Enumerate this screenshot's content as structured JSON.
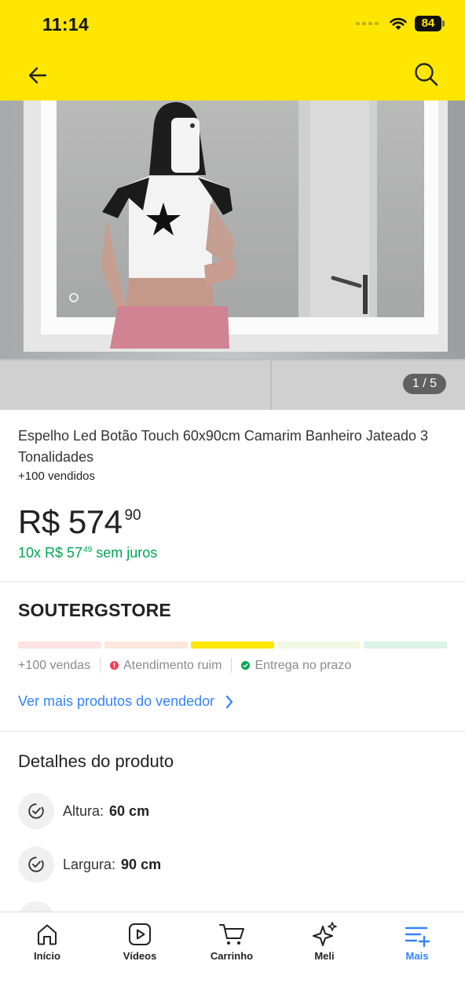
{
  "status_bar": {
    "time": "11:14",
    "battery": "84"
  },
  "colors": {
    "header_bg": "#ffe600",
    "accent_blue": "#3483fa",
    "green": "#00a650",
    "red": "#f23d4f"
  },
  "header": {
    "back_icon": "arrow-left-icon",
    "search_icon": "search-icon"
  },
  "gallery": {
    "counter": "1 / 5"
  },
  "product": {
    "title": "Espelho Led Botão Touch 60x90cm Camarim Banheiro Jateado 3 Tonalidades",
    "sold": "+100 vendidos",
    "price_main": "R$ 574",
    "price_cents": "90",
    "installments_prefix": "10x R$ 57",
    "installments_cents": "49",
    "installments_suffix": "sem juros"
  },
  "seller": {
    "name": "SOUTERGSTORE",
    "reputation_segments": [
      "#fde8e8",
      "#fde9e0",
      "#ffe600",
      "#f2fbe4",
      "#e4f6ec"
    ],
    "sales": "+100 vendas",
    "service": "Atendimento ruim",
    "delivery": "Entrega no prazo",
    "see_more": "Ver mais produtos do vendedor"
  },
  "details": {
    "title": "Detalhes do produto",
    "specs": [
      {
        "label": "Altura:",
        "value": "60 cm"
      },
      {
        "label": "Largura:",
        "value": "90 cm"
      }
    ]
  },
  "tabbar": {
    "items": [
      {
        "label": "Início",
        "icon": "home-icon"
      },
      {
        "label": "Vídeos",
        "icon": "play-icon"
      },
      {
        "label": "Carrinho",
        "icon": "cart-icon"
      },
      {
        "label": "Meli",
        "icon": "sparkle-icon"
      },
      {
        "label": "Mais",
        "icon": "menu-plus-icon"
      }
    ],
    "active": "Mais"
  }
}
